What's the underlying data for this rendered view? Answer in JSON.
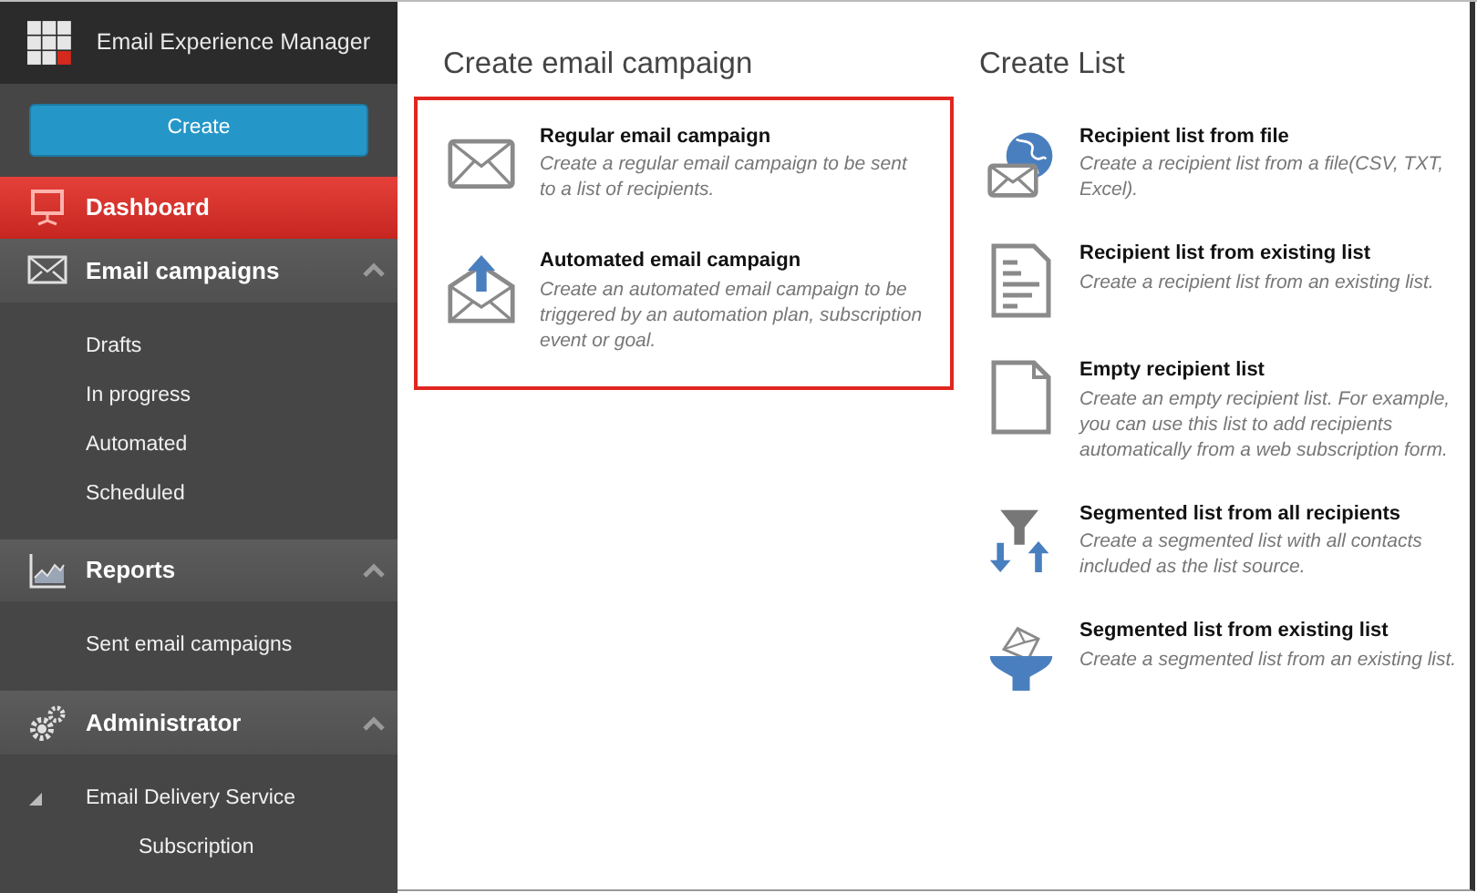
{
  "app": {
    "title": "Email Experience Manager"
  },
  "create_button": "Create",
  "nav": [
    {
      "kind": "presentation",
      "label": "Dashboard",
      "selected": true
    },
    {
      "kind": "envelope",
      "label": "Email campaigns",
      "selected": false,
      "expanded": true,
      "children": [
        {
          "label": "Drafts"
        },
        {
          "label": "In progress"
        },
        {
          "label": "Automated"
        },
        {
          "label": "Scheduled"
        }
      ]
    },
    {
      "kind": "chart",
      "label": "Reports",
      "selected": false,
      "expanded": true,
      "children": [
        {
          "label": "Sent email campaigns"
        }
      ]
    },
    {
      "kind": "gears",
      "label": "Administrator",
      "selected": false,
      "expanded": true,
      "children": [
        {
          "label": "Email Delivery Service",
          "expanded": true,
          "children": [
            {
              "label": "Subscription"
            }
          ]
        }
      ]
    }
  ],
  "columns": [
    {
      "title": "Create email campaign",
      "highlighted": true,
      "options": [
        {
          "kind": "envelope",
          "title": "Regular email campaign",
          "description": "Create a regular email campaign to be sent to a list of recipients."
        },
        {
          "kind": "envelope-upload",
          "title": "Automated email campaign",
          "description": "Create an automated email campaign to be triggered by an automation plan, subscription event or goal."
        }
      ]
    },
    {
      "title": "Create List",
      "highlighted": false,
      "options": [
        {
          "kind": "globe-envelope",
          "title": "Recipient list from file",
          "description": "Create a recipient list from a file(CSV, TXT, Excel)."
        },
        {
          "kind": "document",
          "title": "Recipient list from existing list",
          "description": "Create a recipient list from an existing list."
        },
        {
          "kind": "blank-document",
          "title": "Empty recipient list",
          "description": "Create an empty recipient list. For example, you can use this list to add recipients automatically from a web subscription form."
        },
        {
          "kind": "funnel-arrows",
          "title": "Segmented list from all recipients",
          "description": "Create a segmented list with all contacts included as the list source."
        },
        {
          "kind": "funnel-envelope",
          "title": "Segmented list from existing list",
          "description": "Create a segmented list from an existing list."
        }
      ]
    }
  ]
}
